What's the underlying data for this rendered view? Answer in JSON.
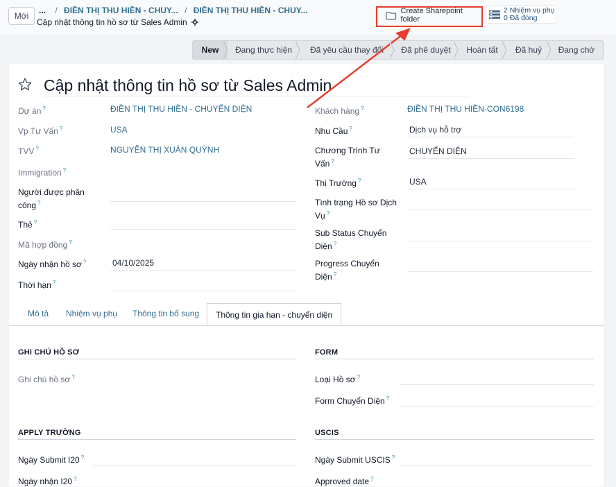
{
  "header": {
    "new_button": "Mới",
    "breadcrumb_dots": "...",
    "breadcrumb_1": "ĐIỀN THỊ THU HIỀN - CHUY...",
    "breadcrumb_2": "ĐIỀN THỊ THU HIỀN - CHUY...",
    "record_title": "Cập nhật thông tin hồ sơ từ Sales Admin",
    "sharepoint_button": "Create Sharepoint folder",
    "tasks_line1": "2 Nhiệm vụ phụ",
    "tasks_line2": "0 Đã đóng"
  },
  "stages": [
    "New",
    "Đang thực hiện",
    "Đã yêu cầu thay đổi",
    "Đã phê duyệt",
    "Hoàn tất",
    "Đã huỷ",
    "Đang chờ"
  ],
  "active_stage": "New",
  "form": {
    "title": "Cập nhật thông tin hồ sơ từ Sales Admin",
    "left": {
      "du_an_label": "Dự án",
      "du_an_value": "ĐIỀN THỊ THU HIỀN - CHUYỂN DIỆN",
      "vp_label": "Vp Tư Vấn",
      "vp_value": "USA",
      "tvv_label": "TVV",
      "tvv_value": "NGUYỄN THỊ XUÂN QUỲNH",
      "immigration_label": "Immigration",
      "assignee_label": "Người được phân công",
      "tag_label": "Thẻ",
      "contract_label": "Mã hợp đồng",
      "received_label": "Ngày nhận hồ sơ",
      "received_value": "04/10/2025",
      "deadline_label": "Thời hạn"
    },
    "right": {
      "customer_label": "Khách hàng",
      "customer_value": "ĐIỀN THỊ THU HIỀN-CON6198",
      "need_label": "Nhu Cầu",
      "need_value": "Dịch vụ hỗ trợ",
      "program_label": "Chương Trình Tư Vấn",
      "program_value": "CHUYỂN DIỆN",
      "market_label": "Thị Trường",
      "market_value": "USA",
      "status_label": "Tình trạng Hồ sơ Dịch Vụ",
      "substatus_label": "Sub Status Chuyển Diện",
      "progress_label": "Progress Chuyển Diện"
    }
  },
  "tabs": [
    "Mô tả",
    "Nhiệm vụ phụ",
    "Thông tin bổ sung",
    "Thông tin gia hạn - chuyển diện"
  ],
  "active_tab": "Thông tin gia hạn - chuyển diện",
  "panel": {
    "notes_section": "GHI CHÚ HỒ SƠ",
    "notes_label": "Ghi chú hồ sơ",
    "form_section": "FORM",
    "form_type_label": "Loại Hồ sơ",
    "form_change_label": "Form Chuyển Diện",
    "apply_section": "APPLY TRƯỜNG",
    "submit_i20_label": "Ngày Submit I20",
    "receive_i20_label": "Ngày nhận I20",
    "uscis_section": "USCIS",
    "submit_uscis_label": "Ngày Submit USCIS",
    "approved_label": "Approved date"
  },
  "colors": {
    "annotation_red": "#e53e2d",
    "link": "#2f6f8f",
    "help": "#2f8fb0"
  }
}
